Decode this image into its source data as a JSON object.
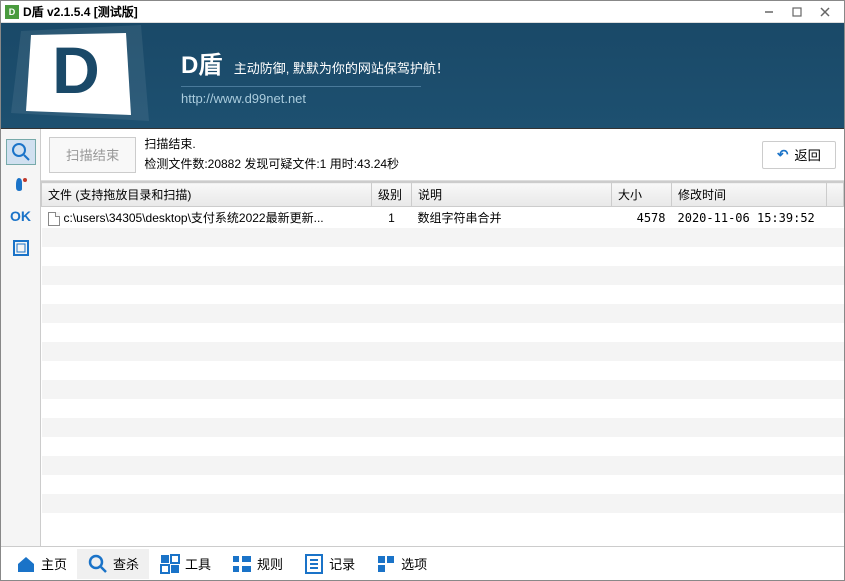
{
  "window": {
    "title": "D盾 v2.1.5.4 [测试版]"
  },
  "banner": {
    "title": "D盾",
    "subtitle": "主动防御, 默默为你的网站保驾护航！",
    "url": "http://www.d99net.net"
  },
  "sidebar": {
    "items": [
      {
        "name": "search",
        "label": ""
      },
      {
        "name": "gesture",
        "label": ""
      },
      {
        "name": "ok",
        "label": "OK"
      },
      {
        "name": "box",
        "label": ""
      }
    ]
  },
  "toolbar": {
    "scan_button": "扫描结束",
    "status_line1": "扫描结束.",
    "status_line2": "检测文件数:20882 发现可疑文件:1 用时:43.24秒",
    "back_button": "返回"
  },
  "table": {
    "headers": {
      "file": "文件 (支持拖放目录和扫描)",
      "level": "级别",
      "desc": "说明",
      "size": "大小",
      "time": "修改时间"
    },
    "rows": [
      {
        "file": "c:\\users\\34305\\desktop\\支付系统2022最新更新...",
        "level": "1",
        "desc": "数组字符串合并",
        "size": "4578",
        "time": "2020-11-06 15:39:52"
      }
    ]
  },
  "bottomnav": {
    "items": [
      {
        "id": "home",
        "label": "主页"
      },
      {
        "id": "scan",
        "label": "查杀"
      },
      {
        "id": "tools",
        "label": "工具"
      },
      {
        "id": "rules",
        "label": "规则"
      },
      {
        "id": "logs",
        "label": "记录"
      },
      {
        "id": "options",
        "label": "选项"
      }
    ]
  }
}
